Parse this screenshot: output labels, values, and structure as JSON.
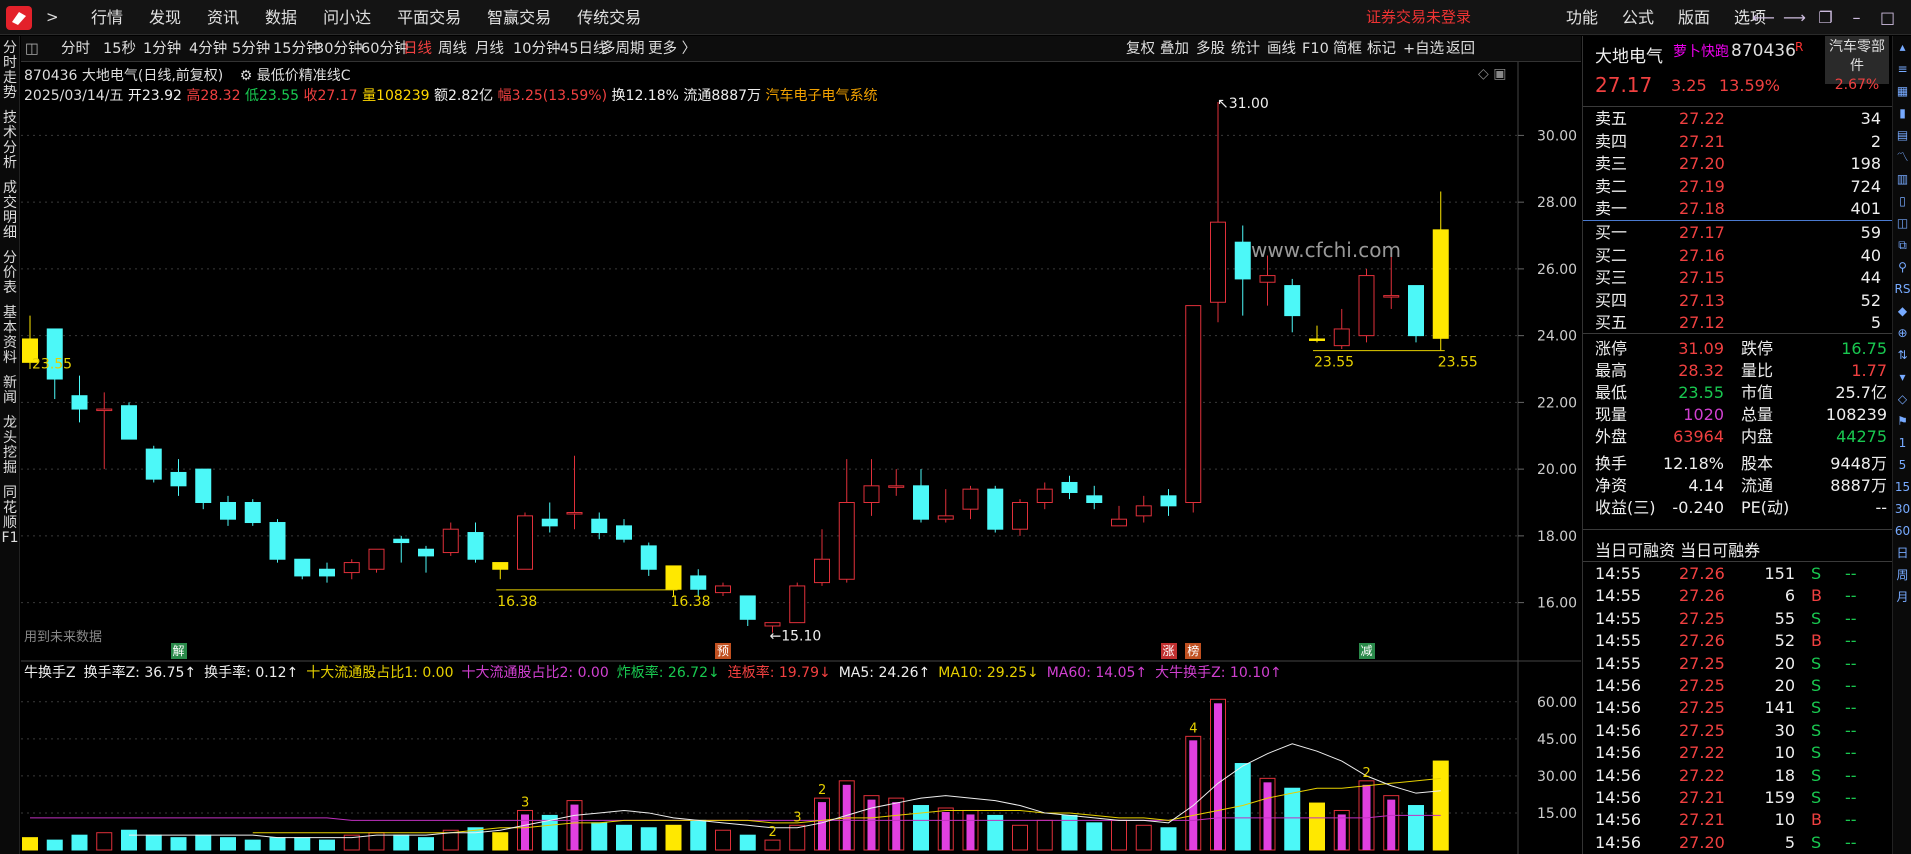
{
  "menu": [
    "行情",
    "发现",
    "资讯",
    "数据",
    "问小达",
    "平面交易",
    "智赢交易",
    "传统交易"
  ],
  "login_warning": "证券交易未登录",
  "right_menu": [
    "功能",
    "公式",
    "版面",
    "选项"
  ],
  "sidebar": [
    "分时走势",
    "技术分析",
    "成交明细",
    "分价表",
    "基本资料",
    "新闻",
    "龙头挖掘",
    "同花顺F1"
  ],
  "periods": [
    "分时",
    "15秒",
    "1分钟",
    "4分钟",
    "5分钟",
    "15分钟",
    "30分钟",
    "60分钟",
    "日线",
    "周线",
    "月线",
    "10分钟",
    "45日线",
    "多周期",
    "更多 〉"
  ],
  "active_period": "日线",
  "tools": [
    "复权",
    "叠加",
    "多股",
    "统计",
    "画线",
    "F10",
    "简框",
    "标记",
    "+自选",
    "返回"
  ],
  "stock": {
    "code": "870436",
    "name": "大地电气",
    "label": "870436 大地电气(日线,前复权)",
    "indicator": "最低价精准线C",
    "sector": "汽车零部件",
    "sector_change": "2.67%",
    "tag": "萝卜快跑",
    "R": "R"
  },
  "bar_info": {
    "date": "2025/03/14/五",
    "open": "开23.92",
    "high": "高28.32",
    "low": "低23.55",
    "close": "收27.17",
    "vol": "量108239",
    "amount": "额2.82亿",
    "range": "幅3.25(13.59%)",
    "turnover": "换12.18%",
    "float": "流通8887万",
    "concept": "汽车电子电气系统"
  },
  "quote": {
    "price": "27.17",
    "change": "3.25",
    "pct": "13.59%"
  },
  "order_book": {
    "asks": [
      {
        "label": "卖五",
        "price": "27.22",
        "vol": "34"
      },
      {
        "label": "卖四",
        "price": "27.21",
        "vol": "2"
      },
      {
        "label": "卖三",
        "price": "27.20",
        "vol": "198"
      },
      {
        "label": "卖二",
        "price": "27.19",
        "vol": "724"
      },
      {
        "label": "卖一",
        "price": "27.18",
        "vol": "401"
      }
    ],
    "bids": [
      {
        "label": "买一",
        "price": "27.17",
        "vol": "59"
      },
      {
        "label": "买二",
        "price": "27.16",
        "vol": "40"
      },
      {
        "label": "买三",
        "price": "27.15",
        "vol": "44"
      },
      {
        "label": "买四",
        "price": "27.13",
        "vol": "52"
      },
      {
        "label": "买五",
        "price": "27.12",
        "vol": "5"
      }
    ]
  },
  "stats": [
    [
      {
        "l": "涨停",
        "v": "31.09",
        "c": "red"
      },
      {
        "l": "跌停",
        "v": "16.75",
        "c": "green"
      }
    ],
    [
      {
        "l": "最高",
        "v": "28.32",
        "c": "red"
      },
      {
        "l": "量比",
        "v": "1.77",
        "c": "red"
      }
    ],
    [
      {
        "l": "最低",
        "v": "23.55",
        "c": "green"
      },
      {
        "l": "市值",
        "v": "25.7亿",
        "c": "wht"
      }
    ],
    [
      {
        "l": "现量",
        "v": "1020",
        "c": "mag"
      },
      {
        "l": "总量",
        "v": "108239",
        "c": "wht"
      }
    ],
    [
      {
        "l": "外盘",
        "v": "63964",
        "c": "red"
      },
      {
        "l": "内盘",
        "v": "44275",
        "c": "green"
      }
    ],
    [
      {
        "l": "换手",
        "v": "12.18%",
        "c": "wht"
      },
      {
        "l": "股本",
        "v": "9448万",
        "c": "wht"
      }
    ],
    [
      {
        "l": "净资",
        "v": "4.14",
        "c": "wht"
      },
      {
        "l": "流通",
        "v": "8887万",
        "c": "wht"
      }
    ],
    [
      {
        "l": "收益(三)",
        "v": "-0.240",
        "c": "wht"
      },
      {
        "l": "PE(动)",
        "v": "--",
        "c": "wht"
      }
    ]
  ],
  "margin_header": "当日可融资 当日可融券",
  "ticks": [
    {
      "t": "14:55",
      "p": "27.26",
      "v": "151",
      "s": "S"
    },
    {
      "t": "14:55",
      "p": "27.26",
      "v": "6",
      "s": "B"
    },
    {
      "t": "14:55",
      "p": "27.25",
      "v": "55",
      "s": "S"
    },
    {
      "t": "14:55",
      "p": "27.26",
      "v": "52",
      "s": "B"
    },
    {
      "t": "14:55",
      "p": "27.25",
      "v": "20",
      "s": "S"
    },
    {
      "t": "14:56",
      "p": "27.25",
      "v": "20",
      "s": "S"
    },
    {
      "t": "14:56",
      "p": "27.25",
      "v": "141",
      "s": "S"
    },
    {
      "t": "14:56",
      "p": "27.25",
      "v": "30",
      "s": "S"
    },
    {
      "t": "14:56",
      "p": "27.22",
      "v": "10",
      "s": "S"
    },
    {
      "t": "14:56",
      "p": "27.22",
      "v": "18",
      "s": "S"
    },
    {
      "t": "14:56",
      "p": "27.21",
      "v": "159",
      "s": "S"
    },
    {
      "t": "14:56",
      "p": "27.21",
      "v": "10",
      "s": "B"
    },
    {
      "t": "14:56",
      "p": "27.20",
      "v": "5",
      "s": "S"
    }
  ],
  "tick_dash": "--",
  "future_data_label": "用到未来数据",
  "watermark": "www.cfchi.com",
  "event_markers": [
    {
      "text": "解",
      "c": "#2a8a4a"
    },
    {
      "text": "预",
      "c": "#c05020"
    },
    {
      "text": "涨",
      "c": "#c03030"
    },
    {
      "text": "榜",
      "c": "#c05020"
    },
    {
      "text": "减",
      "c": "#2a8a4a"
    }
  ],
  "indicator_header": [
    {
      "t": "牛换手Z",
      "c": "wht"
    },
    {
      "t": "换手率Z: 36.75↑",
      "c": "wht"
    },
    {
      "t": "换手率: 0.12↑",
      "c": "wht"
    },
    {
      "t": "十大流通股占比1: 0.00",
      "c": "yel"
    },
    {
      "t": "十大流通股占比2: 0.00",
      "c": "mag"
    },
    {
      "t": "炸板率: 26.72↓",
      "c": "green"
    },
    {
      "t": "连板率: 19.79↓",
      "c": "red"
    },
    {
      "t": "MA5: 24.26↑",
      "c": "wht"
    },
    {
      "t": "MA10: 29.25↓",
      "c": "yel"
    },
    {
      "t": "MA60: 14.05↑",
      "c": "mag"
    },
    {
      "t": "大牛换手Z: 10.10↑",
      "c": "mag"
    }
  ],
  "chart_data": {
    "type": "candlestick",
    "price_axis": [
      30,
      28,
      26,
      24,
      22,
      20,
      18,
      16
    ],
    "price_ylim": [
      14.7,
      31.9
    ],
    "annotations": [
      {
        "text": "31.00",
        "price": 31.0
      },
      {
        "text": "15.10",
        "price": 15.1
      },
      {
        "text": "16.38",
        "price": 16.38
      },
      {
        "text": "16.38",
        "price": 16.38
      },
      {
        "text": "23.55",
        "price": 23.55
      },
      {
        "text": "23.55",
        "price": 23.55
      },
      {
        "text": "23.55",
        "price": 23.55
      }
    ],
    "candles": [
      [
        23.9,
        23.2,
        24.6,
        23.0
      ],
      [
        24.2,
        22.7,
        24.2,
        22.1
      ],
      [
        22.2,
        21.8,
        22.8,
        21.4
      ],
      [
        21.8,
        21.8,
        22.3,
        20.0
      ],
      [
        21.9,
        20.9,
        22.0,
        20.9
      ],
      [
        20.6,
        19.7,
        20.7,
        19.6
      ],
      [
        19.9,
        19.5,
        20.3,
        19.2
      ],
      [
        20.0,
        19.0,
        20.0,
        18.8
      ],
      [
        19.0,
        18.5,
        19.2,
        18.3
      ],
      [
        19.0,
        18.4,
        19.1,
        18.3
      ],
      [
        18.4,
        17.3,
        18.5,
        17.2
      ],
      [
        17.3,
        16.8,
        17.3,
        16.7
      ],
      [
        17.0,
        16.8,
        17.2,
        16.6
      ],
      [
        16.9,
        17.2,
        17.3,
        16.7
      ],
      [
        17.0,
        17.6,
        17.6,
        16.9
      ],
      [
        17.9,
        17.8,
        18.0,
        17.2
      ],
      [
        17.6,
        17.4,
        17.7,
        16.9
      ],
      [
        17.5,
        18.2,
        18.4,
        17.4
      ],
      [
        18.1,
        17.3,
        18.4,
        17.2
      ],
      [
        17.2,
        17.0,
        17.2,
        16.7
      ],
      [
        17.0,
        18.6,
        18.7,
        17.0
      ],
      [
        18.5,
        18.3,
        19.0,
        18.1
      ],
      [
        18.7,
        18.7,
        20.4,
        18.2
      ],
      [
        18.5,
        18.1,
        18.7,
        17.9
      ],
      [
        18.3,
        17.9,
        18.5,
        17.8
      ],
      [
        17.7,
        17.0,
        17.8,
        16.8
      ],
      [
        17.1,
        16.4,
        17.1,
        16.2
      ],
      [
        16.8,
        16.4,
        17.0,
        16.2
      ],
      [
        16.3,
        16.5,
        16.6,
        16.2
      ],
      [
        16.2,
        15.5,
        16.2,
        15.3
      ],
      [
        15.3,
        15.4,
        15.4,
        15.1
      ],
      [
        15.4,
        16.5,
        16.6,
        15.4
      ],
      [
        16.6,
        17.3,
        18.2,
        16.5
      ],
      [
        16.7,
        19.0,
        20.3,
        16.6
      ],
      [
        19.0,
        19.5,
        20.3,
        18.6
      ],
      [
        19.5,
        19.5,
        20.0,
        19.2
      ],
      [
        19.5,
        18.5,
        20.0,
        18.4
      ],
      [
        18.5,
        18.6,
        19.4,
        18.4
      ],
      [
        18.8,
        19.4,
        19.5,
        18.5
      ],
      [
        19.4,
        18.2,
        19.5,
        18.1
      ],
      [
        18.2,
        19.0,
        19.1,
        18.0
      ],
      [
        19.0,
        19.4,
        19.6,
        18.8
      ],
      [
        19.6,
        19.3,
        19.8,
        19.1
      ],
      [
        19.2,
        19.0,
        19.5,
        18.8
      ],
      [
        18.3,
        18.5,
        18.9,
        18.3
      ],
      [
        18.6,
        18.9,
        19.2,
        18.4
      ],
      [
        19.2,
        18.9,
        19.4,
        18.6
      ],
      [
        19.0,
        24.9,
        24.9,
        18.7
      ],
      [
        25.0,
        27.4,
        31.0,
        24.4
      ],
      [
        26.8,
        25.7,
        27.3,
        24.6
      ],
      [
        25.6,
        25.8,
        26.4,
        24.9
      ],
      [
        25.5,
        24.6,
        25.7,
        24.1
      ],
      [
        23.9,
        23.9,
        24.3,
        23.8
      ],
      [
        23.7,
        24.2,
        24.8,
        23.6
      ],
      [
        24.0,
        25.8,
        26.0,
        23.8
      ],
      [
        25.2,
        25.2,
        26.5,
        24.8
      ],
      [
        25.5,
        24.0,
        25.5,
        23.8
      ],
      [
        23.92,
        27.17,
        28.32,
        23.55
      ]
    ],
    "yellow_candles": [
      0,
      19,
      26,
      52,
      57
    ],
    "vol_axis": [
      60.0,
      45.0,
      30.0,
      15.0
    ],
    "vol_ylim": [
      0,
      68
    ],
    "turnover": [
      5,
      4,
      6,
      7,
      8,
      6,
      5,
      6,
      5,
      4,
      5,
      5,
      4,
      6,
      7,
      6,
      5,
      8,
      9,
      7,
      16,
      14,
      20,
      11,
      10,
      9,
      10,
      12,
      8,
      6,
      4,
      10,
      21,
      28,
      22,
      21,
      18,
      17,
      16,
      14,
      10,
      12,
      14,
      11,
      12,
      10,
      9,
      46,
      61,
      35,
      29,
      25,
      19,
      16,
      28,
      22,
      18,
      36
    ],
    "bar_numbers": [
      {
        "i": 20,
        "t": "3"
      },
      {
        "i": 32,
        "t": "2"
      },
      {
        "i": 31,
        "t": "3"
      },
      {
        "i": 30,
        "t": "2"
      },
      {
        "i": 47,
        "t": "4"
      },
      {
        "i": 54,
        "t": "2"
      }
    ],
    "ma_white": [
      null,
      null,
      null,
      null,
      6,
      6,
      6,
      6,
      6,
      6,
      5,
      5,
      5,
      5,
      6,
      6,
      6,
      7,
      7,
      8,
      10,
      12,
      14,
      15,
      16,
      15,
      13,
      12,
      11,
      10,
      9,
      9,
      11,
      14,
      17,
      19,
      21,
      22,
      21,
      20,
      18,
      15,
      14,
      13,
      12,
      12,
      11,
      18,
      27,
      34,
      39,
      43,
      40,
      36,
      30,
      26,
      23,
      24
    ],
    "ma_yellow": [
      null,
      null,
      null,
      null,
      null,
      null,
      null,
      null,
      null,
      7,
      7,
      7,
      7,
      7,
      7,
      7,
      7,
      7,
      8,
      9,
      9,
      10,
      11,
      11,
      12,
      12,
      12,
      12,
      12,
      12,
      11,
      11,
      12,
      13,
      13,
      14,
      15,
      16,
      16,
      16,
      16,
      15,
      15,
      14,
      13,
      13,
      12,
      14,
      16,
      18,
      21,
      23,
      25,
      25,
      26,
      27,
      28,
      29
    ],
    "ma_magenta": [
      13,
      13,
      13,
      13,
      13,
      13,
      13,
      13,
      13,
      13,
      13,
      13,
      13,
      12,
      12,
      12,
      12,
      12,
      12,
      12,
      12,
      12,
      12,
      12,
      12,
      12,
      12,
      12,
      12,
      12,
      12,
      12,
      12,
      12,
      12,
      12,
      12,
      12,
      12,
      12,
      12,
      12,
      12,
      12,
      12,
      12,
      12,
      12,
      13,
      13,
      13,
      13,
      13,
      13,
      13,
      14,
      14,
      14
    ]
  }
}
